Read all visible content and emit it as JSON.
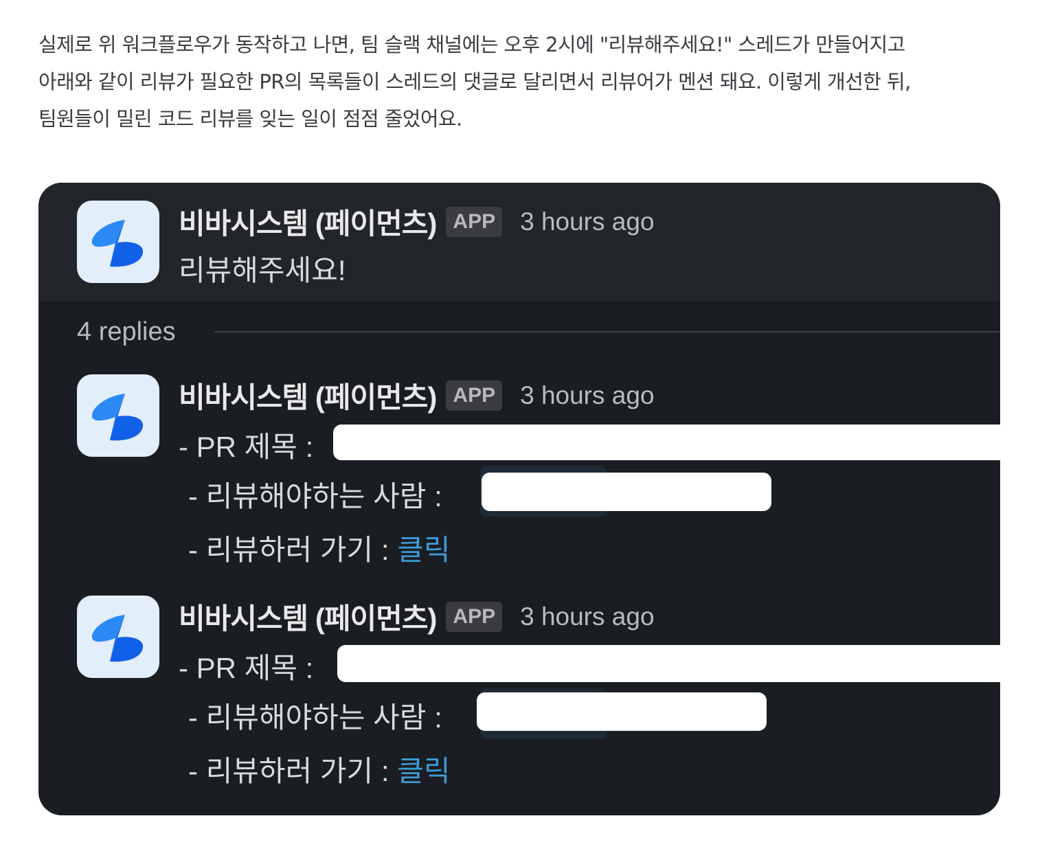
{
  "intro": {
    "line1": "실제로 위 워크플로우가 동작하고 나면, 팀 슬랙 채널에는 오후 2시에 \"리뷰해주세요!\" 스레드가 만들어지고",
    "line2": "아래와 같이 리뷰가 필요한 PR의 목록들이 스레드의 댓글로 달리면서 리뷰어가 멘션 돼요. 이렇게 개선한 뒤,",
    "line3": "팀원들이 밀린 코드 리뷰를 잊는 일이 점점 줄었어요."
  },
  "colors": {
    "slack_bg": "#1a1d21",
    "link": "#3d9ad8",
    "avatar_bg": "#e3eefb",
    "logo_blue": "#1f6ff0"
  },
  "thread": {
    "parent": {
      "avatar_icon": "toss-payments-logo-icon",
      "sender": "비바시스템 (페이먼츠)",
      "badge": "APP",
      "time": "3 hours ago",
      "text": "리뷰해주세요!"
    },
    "replies_label": "4 replies",
    "replies": [
      {
        "avatar_icon": "toss-payments-logo-icon",
        "sender": "비바시스템 (페이먼츠)",
        "badge": "APP",
        "time": "3 hours ago",
        "pr_title_label": "- PR 제목 :",
        "reviewer_label": "- 리뷰해야하는 사람 :",
        "goto_label": "- 리뷰하러 가기 :",
        "goto_link": "클릭"
      },
      {
        "avatar_icon": "toss-payments-logo-icon",
        "sender": "비바시스템 (페이먼츠)",
        "badge": "APP",
        "time": "3 hours ago",
        "pr_title_label": "- PR 제목 :",
        "reviewer_label": "- 리뷰해야하는 사람 :",
        "goto_label": "- 리뷰하러 가기 :",
        "goto_link": "클릭"
      }
    ]
  }
}
